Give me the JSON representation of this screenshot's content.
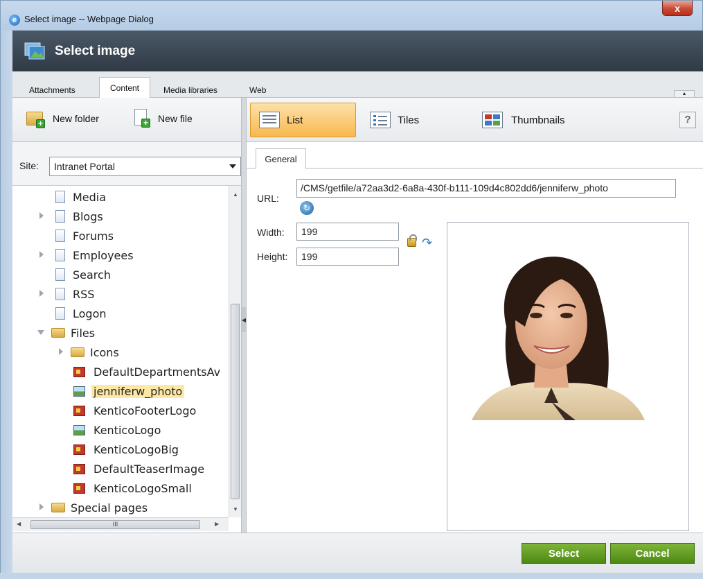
{
  "window": {
    "title": "Select image -- Webpage Dialog",
    "close_glyph": "x",
    "icon_glyph": "e"
  },
  "header": {
    "title": "Select image"
  },
  "tabs": [
    {
      "label": "Attachments"
    },
    {
      "label": "Content"
    },
    {
      "label": "Media libraries"
    },
    {
      "label": "Web"
    }
  ],
  "left_toolbar": {
    "new_folder": "New folder",
    "new_file": "New file"
  },
  "view_toolbar": {
    "list": "List",
    "tiles": "Tiles",
    "thumbnails": "Thumbnails",
    "help": "?"
  },
  "site": {
    "label": "Site:",
    "value": "Intranet Portal"
  },
  "tree": {
    "items": [
      {
        "label": "Media"
      },
      {
        "label": "Blogs"
      },
      {
        "label": "Forums"
      },
      {
        "label": "Employees"
      },
      {
        "label": "Search"
      },
      {
        "label": "RSS"
      },
      {
        "label": "Logon"
      },
      {
        "label": "Files"
      },
      {
        "label": "Icons"
      },
      {
        "label": "DefaultDepartmentsAv"
      },
      {
        "label": "jenniferw_photo"
      },
      {
        "label": "KenticoFooterLogo"
      },
      {
        "label": "KenticoLogo"
      },
      {
        "label": "KenticoLogoBig"
      },
      {
        "label": "DefaultTeaserImage"
      },
      {
        "label": "KenticoLogoSmall"
      },
      {
        "label": "Special pages"
      }
    ],
    "hscroll_grip": "III"
  },
  "properties": {
    "tab": "General",
    "url_label": "URL:",
    "url_value": "/CMS/getfile/a72aa3d2-6a8a-430f-b111-109d4c802dd6/jenniferw_photo",
    "width_label": "Width:",
    "width_value": "199",
    "height_label": "Height:",
    "height_value": "199"
  },
  "footer": {
    "select": "Select",
    "cancel": "Cancel"
  },
  "colors": {
    "accent_green": "#5e9a1f",
    "list_active": "#f8b84e",
    "header_dark": "#36424e"
  }
}
